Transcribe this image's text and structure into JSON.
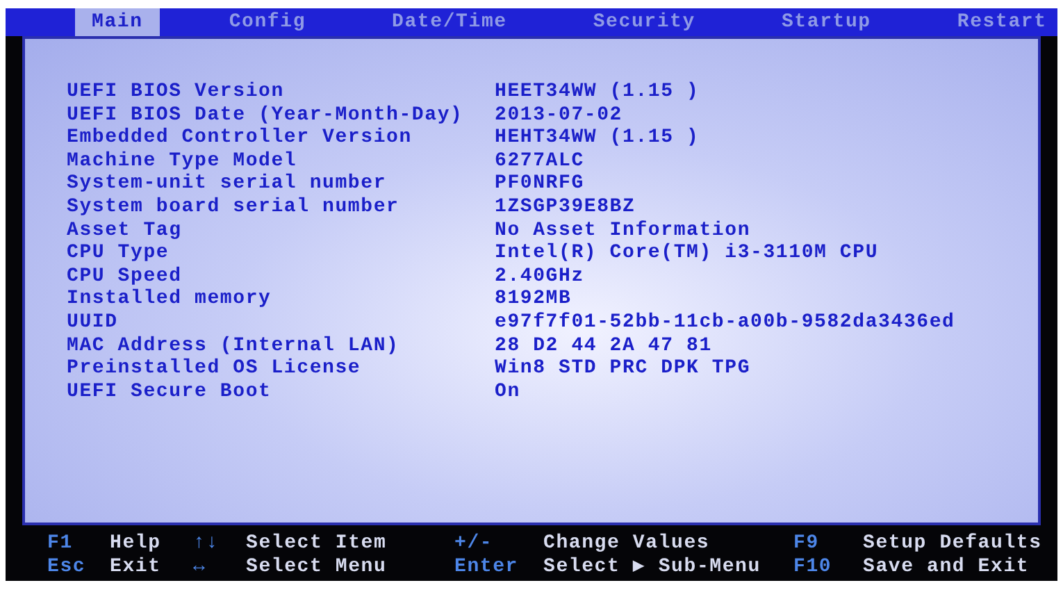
{
  "tabs": [
    {
      "label": "Main",
      "selected": true
    },
    {
      "label": "Config",
      "selected": false
    },
    {
      "label": "Date/Time",
      "selected": false
    },
    {
      "label": "Security",
      "selected": false
    },
    {
      "label": "Startup",
      "selected": false
    },
    {
      "label": "Restart",
      "selected": false
    }
  ],
  "fields": [
    {
      "label": "UEFI BIOS Version",
      "value": "HEET34WW (1.15 )"
    },
    {
      "label": "UEFI BIOS Date (Year-Month-Day)",
      "value": "2013-07-02"
    },
    {
      "label": "Embedded Controller Version",
      "value": "HEHT34WW (1.15 )"
    },
    {
      "label": "Machine Type Model",
      "value": "6277ALC"
    },
    {
      "label": "System-unit serial number",
      "value": "PF0NRFG"
    },
    {
      "label": "System board serial number",
      "value": "1ZSGP39E8BZ"
    },
    {
      "label": "Asset Tag",
      "value": "No Asset Information"
    },
    {
      "label": "CPU Type",
      "value": "Intel(R) Core(TM) i3-3110M CPU"
    },
    {
      "label": "CPU Speed",
      "value": "2.40GHz"
    },
    {
      "label": "Installed memory",
      "value": "8192MB"
    },
    {
      "label": "UUID",
      "value": "e97f7f01-52bb-11cb-a00b-9582da3436ed"
    },
    {
      "label": "MAC Address (Internal LAN)",
      "value": "28 D2 44 2A 47 81"
    },
    {
      "label": "Preinstalled OS License",
      "value": "Win8 STD PRC DPK TPG"
    },
    {
      "label": "UEFI Secure Boot",
      "value": "On"
    }
  ],
  "key_help": [
    [
      {
        "key": "F1",
        "action": "Help"
      },
      {
        "key": "↑↓",
        "action": "Select Item"
      },
      {
        "key": "+/-",
        "action": "Change Values"
      },
      {
        "key": "F9",
        "action": "Setup Defaults"
      }
    ],
    [
      {
        "key": "Esc",
        "action": "Exit"
      },
      {
        "key": "↔",
        "action": "Select Menu"
      },
      {
        "key": "Enter",
        "action": "Select ▶ Sub-Menu"
      },
      {
        "key": "F10",
        "action": "Save and Exit"
      }
    ]
  ]
}
